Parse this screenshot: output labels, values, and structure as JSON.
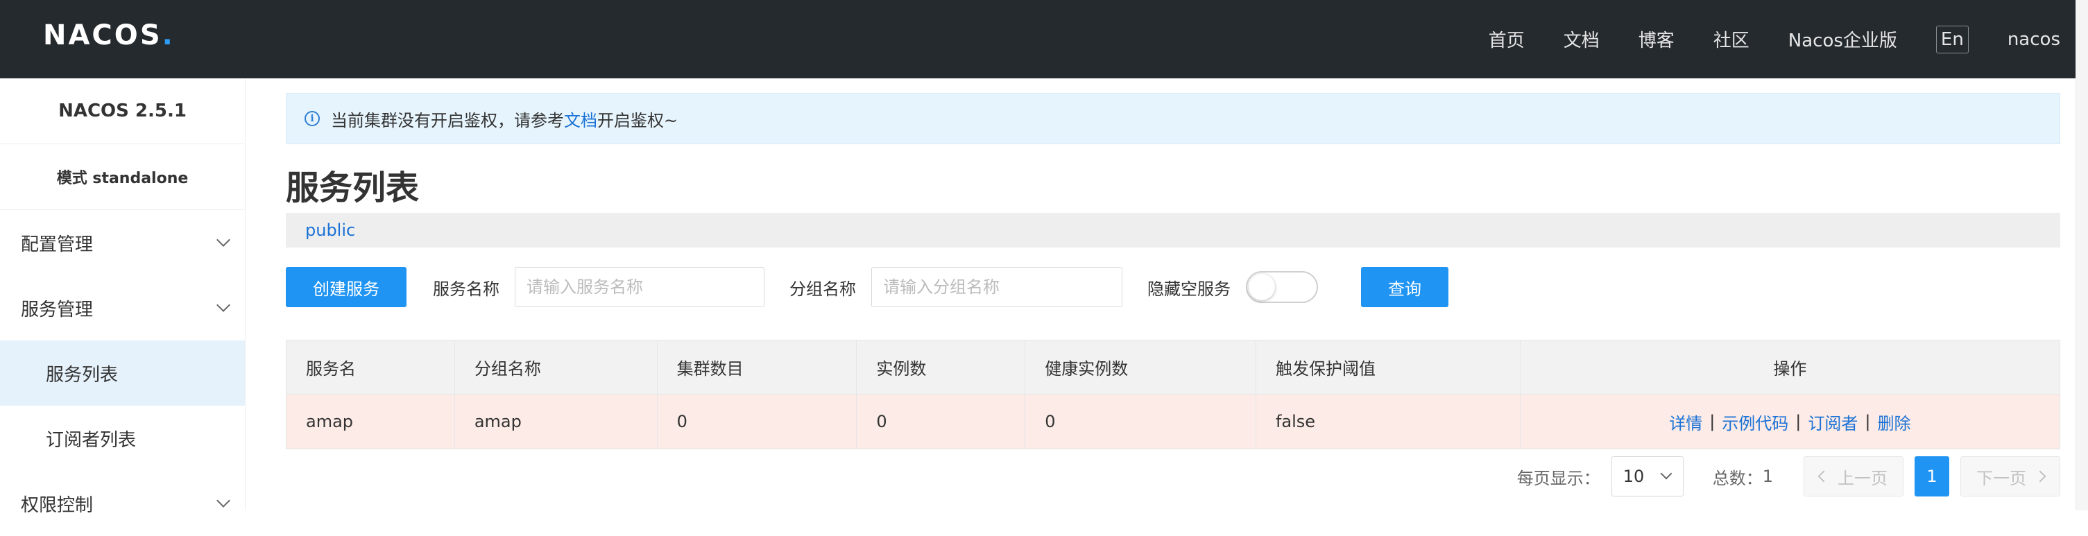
{
  "header": {
    "logo": {
      "text_a": "NAC",
      "text_o": "O",
      "text_b": "S",
      "dot": "."
    },
    "nav": [
      "首页",
      "文档",
      "博客",
      "社区",
      "Nacos企业版"
    ],
    "lang": "En",
    "user": "nacos"
  },
  "sidebar": {
    "version": "NACOS 2.5.1",
    "mode": "模式 standalone",
    "groups": [
      {
        "label": "配置管理"
      },
      {
        "label": "服务管理",
        "items": [
          "服务列表",
          "订阅者列表"
        ]
      },
      {
        "label": "权限控制"
      }
    ],
    "active_item": "服务列表"
  },
  "alert": {
    "text_before": "当前集群没有开启鉴权，请参考",
    "link": "文档",
    "text_after": "开启鉴权~"
  },
  "page_title": "服务列表",
  "namespace": "public",
  "toolbar": {
    "create_button": "创建服务",
    "service_name_label": "服务名称",
    "service_name_placeholder": "请输入服务名称",
    "group_name_label": "分组名称",
    "group_name_placeholder": "请输入分组名称",
    "hide_empty_label": "隐藏空服务",
    "hide_empty_on": false,
    "query_button": "查询"
  },
  "table": {
    "columns": [
      "服务名",
      "分组名称",
      "集群数目",
      "实例数",
      "健康实例数",
      "触发保护阈值",
      "操作"
    ],
    "rows": [
      {
        "service": "amap",
        "group": "amap",
        "clusters": "0",
        "instances": "0",
        "healthy": "0",
        "threshold": "false",
        "ops": [
          "详情",
          "示例代码",
          "订阅者",
          "删除"
        ]
      }
    ]
  },
  "pagination": {
    "per_page_label": "每页显示：",
    "per_page": "10",
    "total_label": "总数：",
    "total": "1",
    "prev": "上一页",
    "current_page": "1",
    "next": "下一页"
  },
  "colors": {
    "header_bg": "#252a2f",
    "primary": "#2094f3",
    "link": "#1b72d6",
    "alert_bg": "#e6f4fd",
    "row_highlight": "#fcebe6",
    "active_menu_bg": "#e6f2fb"
  }
}
